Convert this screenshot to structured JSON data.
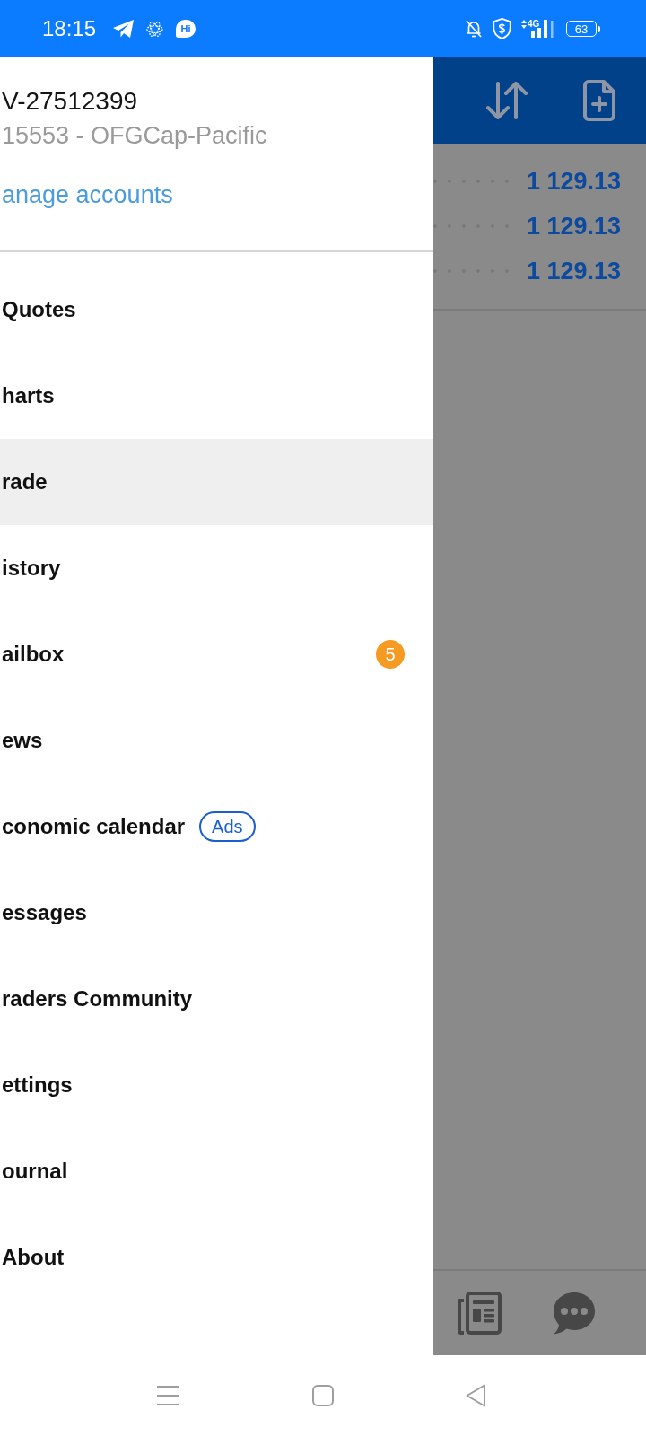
{
  "status_bar": {
    "time": "18:15",
    "app_badge": "Hi",
    "network": "4G",
    "battery": "63"
  },
  "drawer": {
    "account": {
      "login": "V-27512399",
      "server": "15553 - OFGCap-Pacific",
      "manage_link": "anage accounts"
    },
    "menu": [
      {
        "label": "Quotes",
        "selected": false
      },
      {
        "label": "harts",
        "selected": false
      },
      {
        "label": "rade",
        "selected": true
      },
      {
        "label": "istory",
        "selected": false
      },
      {
        "label": "ailbox",
        "selected": false,
        "badge": "5"
      },
      {
        "label": "ews",
        "selected": false
      },
      {
        "label": "conomic calendar",
        "selected": false,
        "tag": "Ads"
      },
      {
        "label": "essages",
        "selected": false
      },
      {
        "label": "raders Community",
        "selected": false
      },
      {
        "label": "ettings",
        "selected": false
      },
      {
        "label": "ournal",
        "selected": false
      },
      {
        "label": "About",
        "selected": false
      }
    ]
  },
  "background_app": {
    "quotes": [
      {
        "price": "1 129.13"
      },
      {
        "price": "1 129.13"
      },
      {
        "price": "1 129.13"
      }
    ]
  }
}
